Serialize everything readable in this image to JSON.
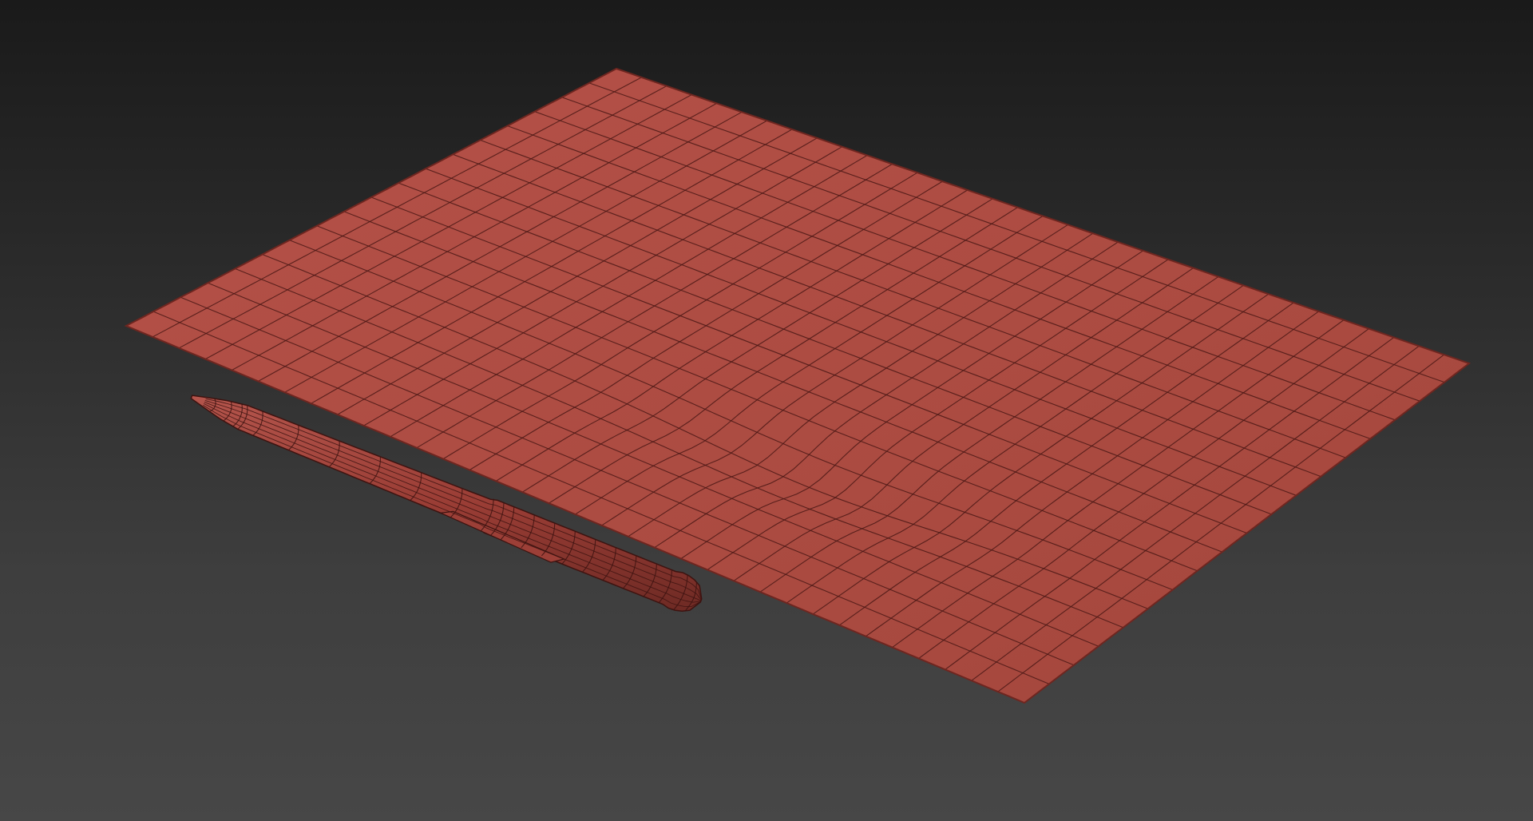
{
  "viewport": {
    "background_top": "#1a1a1a",
    "background_bottom": "#474747"
  },
  "paper": {
    "fill": "#ad4d43",
    "edge_color": "#6e2620",
    "wire_color": "#4a1815",
    "grid_columns": 34,
    "grid_rows": 18
  },
  "pen": {
    "fill": "#9c3f37",
    "wire_color": "#3d1310"
  }
}
